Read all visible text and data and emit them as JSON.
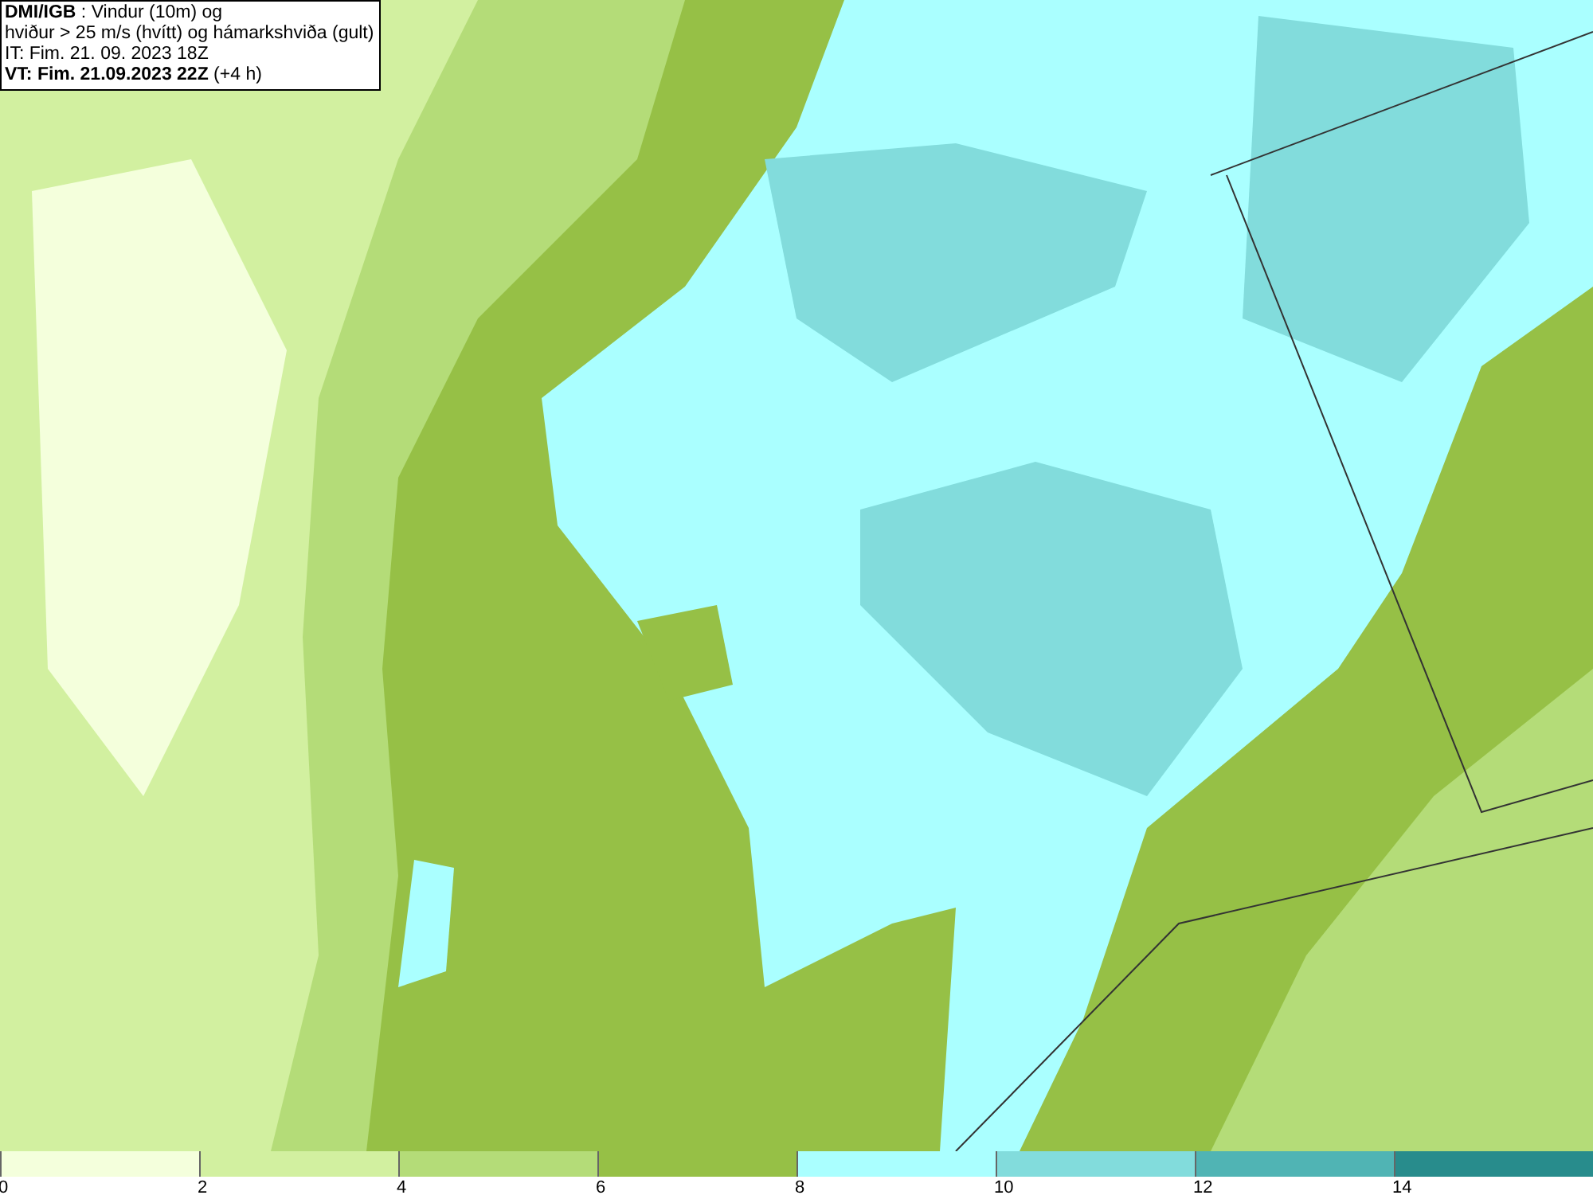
{
  "header": {
    "lines": [
      "**DMI/IGB** : Vindur (10m) og",
      "hviður > 25 m/s (hvítt) og hámarkshviða (gult)",
      "IT: Fim. 21. 09. 2023 18Z",
      "**VT: Fim. 21.09.2023 22Z** (+4 h)"
    ]
  },
  "legend": {
    "bins": [
      {
        "label": "0",
        "color": "#f4ffdc"
      },
      {
        "label": "2",
        "color": "#d2f0a0"
      },
      {
        "label": "4",
        "color": "#b4dc78"
      },
      {
        "label": "6",
        "color": "#96c046"
      },
      {
        "label": "8",
        "color": "#aaffff"
      },
      {
        "label": "10",
        "color": "#82dcdc"
      },
      {
        "label": "12",
        "color": "#50b4b4"
      },
      {
        "label": "14",
        "color": "#288c8c"
      }
    ]
  }
}
